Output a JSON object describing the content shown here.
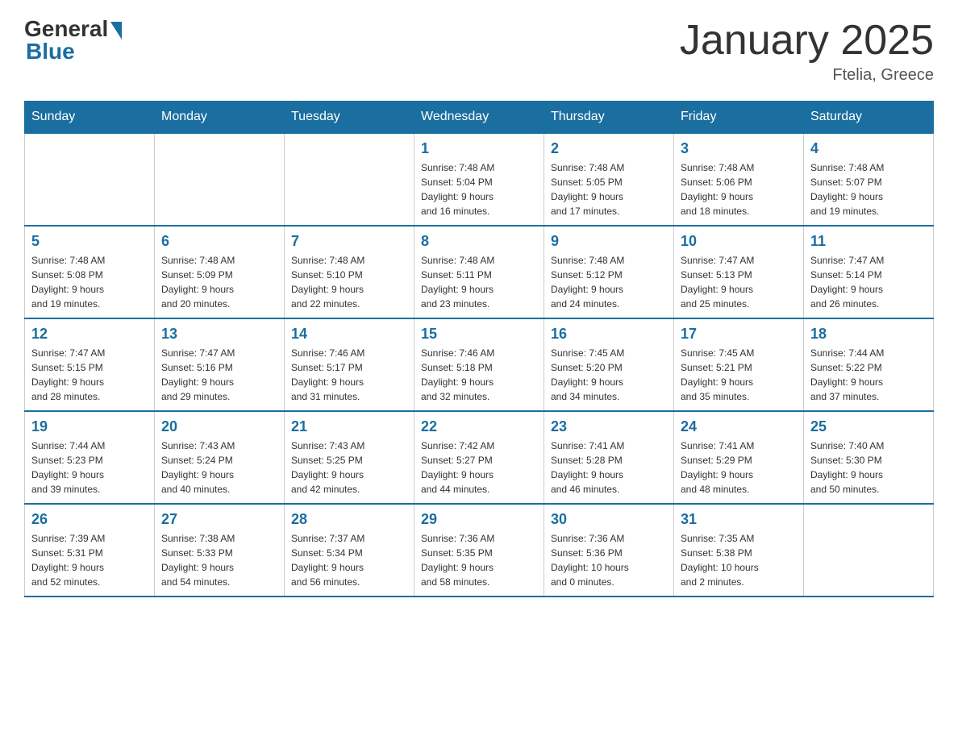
{
  "header": {
    "logo_general": "General",
    "logo_blue": "Blue",
    "main_title": "January 2025",
    "subtitle": "Ftelia, Greece"
  },
  "days_of_week": [
    "Sunday",
    "Monday",
    "Tuesday",
    "Wednesday",
    "Thursday",
    "Friday",
    "Saturday"
  ],
  "weeks": [
    [
      {
        "day": "",
        "info": ""
      },
      {
        "day": "",
        "info": ""
      },
      {
        "day": "",
        "info": ""
      },
      {
        "day": "1",
        "info": "Sunrise: 7:48 AM\nSunset: 5:04 PM\nDaylight: 9 hours\nand 16 minutes."
      },
      {
        "day": "2",
        "info": "Sunrise: 7:48 AM\nSunset: 5:05 PM\nDaylight: 9 hours\nand 17 minutes."
      },
      {
        "day": "3",
        "info": "Sunrise: 7:48 AM\nSunset: 5:06 PM\nDaylight: 9 hours\nand 18 minutes."
      },
      {
        "day": "4",
        "info": "Sunrise: 7:48 AM\nSunset: 5:07 PM\nDaylight: 9 hours\nand 19 minutes."
      }
    ],
    [
      {
        "day": "5",
        "info": "Sunrise: 7:48 AM\nSunset: 5:08 PM\nDaylight: 9 hours\nand 19 minutes."
      },
      {
        "day": "6",
        "info": "Sunrise: 7:48 AM\nSunset: 5:09 PM\nDaylight: 9 hours\nand 20 minutes."
      },
      {
        "day": "7",
        "info": "Sunrise: 7:48 AM\nSunset: 5:10 PM\nDaylight: 9 hours\nand 22 minutes."
      },
      {
        "day": "8",
        "info": "Sunrise: 7:48 AM\nSunset: 5:11 PM\nDaylight: 9 hours\nand 23 minutes."
      },
      {
        "day": "9",
        "info": "Sunrise: 7:48 AM\nSunset: 5:12 PM\nDaylight: 9 hours\nand 24 minutes."
      },
      {
        "day": "10",
        "info": "Sunrise: 7:47 AM\nSunset: 5:13 PM\nDaylight: 9 hours\nand 25 minutes."
      },
      {
        "day": "11",
        "info": "Sunrise: 7:47 AM\nSunset: 5:14 PM\nDaylight: 9 hours\nand 26 minutes."
      }
    ],
    [
      {
        "day": "12",
        "info": "Sunrise: 7:47 AM\nSunset: 5:15 PM\nDaylight: 9 hours\nand 28 minutes."
      },
      {
        "day": "13",
        "info": "Sunrise: 7:47 AM\nSunset: 5:16 PM\nDaylight: 9 hours\nand 29 minutes."
      },
      {
        "day": "14",
        "info": "Sunrise: 7:46 AM\nSunset: 5:17 PM\nDaylight: 9 hours\nand 31 minutes."
      },
      {
        "day": "15",
        "info": "Sunrise: 7:46 AM\nSunset: 5:18 PM\nDaylight: 9 hours\nand 32 minutes."
      },
      {
        "day": "16",
        "info": "Sunrise: 7:45 AM\nSunset: 5:20 PM\nDaylight: 9 hours\nand 34 minutes."
      },
      {
        "day": "17",
        "info": "Sunrise: 7:45 AM\nSunset: 5:21 PM\nDaylight: 9 hours\nand 35 minutes."
      },
      {
        "day": "18",
        "info": "Sunrise: 7:44 AM\nSunset: 5:22 PM\nDaylight: 9 hours\nand 37 minutes."
      }
    ],
    [
      {
        "day": "19",
        "info": "Sunrise: 7:44 AM\nSunset: 5:23 PM\nDaylight: 9 hours\nand 39 minutes."
      },
      {
        "day": "20",
        "info": "Sunrise: 7:43 AM\nSunset: 5:24 PM\nDaylight: 9 hours\nand 40 minutes."
      },
      {
        "day": "21",
        "info": "Sunrise: 7:43 AM\nSunset: 5:25 PM\nDaylight: 9 hours\nand 42 minutes."
      },
      {
        "day": "22",
        "info": "Sunrise: 7:42 AM\nSunset: 5:27 PM\nDaylight: 9 hours\nand 44 minutes."
      },
      {
        "day": "23",
        "info": "Sunrise: 7:41 AM\nSunset: 5:28 PM\nDaylight: 9 hours\nand 46 minutes."
      },
      {
        "day": "24",
        "info": "Sunrise: 7:41 AM\nSunset: 5:29 PM\nDaylight: 9 hours\nand 48 minutes."
      },
      {
        "day": "25",
        "info": "Sunrise: 7:40 AM\nSunset: 5:30 PM\nDaylight: 9 hours\nand 50 minutes."
      }
    ],
    [
      {
        "day": "26",
        "info": "Sunrise: 7:39 AM\nSunset: 5:31 PM\nDaylight: 9 hours\nand 52 minutes."
      },
      {
        "day": "27",
        "info": "Sunrise: 7:38 AM\nSunset: 5:33 PM\nDaylight: 9 hours\nand 54 minutes."
      },
      {
        "day": "28",
        "info": "Sunrise: 7:37 AM\nSunset: 5:34 PM\nDaylight: 9 hours\nand 56 minutes."
      },
      {
        "day": "29",
        "info": "Sunrise: 7:36 AM\nSunset: 5:35 PM\nDaylight: 9 hours\nand 58 minutes."
      },
      {
        "day": "30",
        "info": "Sunrise: 7:36 AM\nSunset: 5:36 PM\nDaylight: 10 hours\nand 0 minutes."
      },
      {
        "day": "31",
        "info": "Sunrise: 7:35 AM\nSunset: 5:38 PM\nDaylight: 10 hours\nand 2 minutes."
      },
      {
        "day": "",
        "info": ""
      }
    ]
  ]
}
